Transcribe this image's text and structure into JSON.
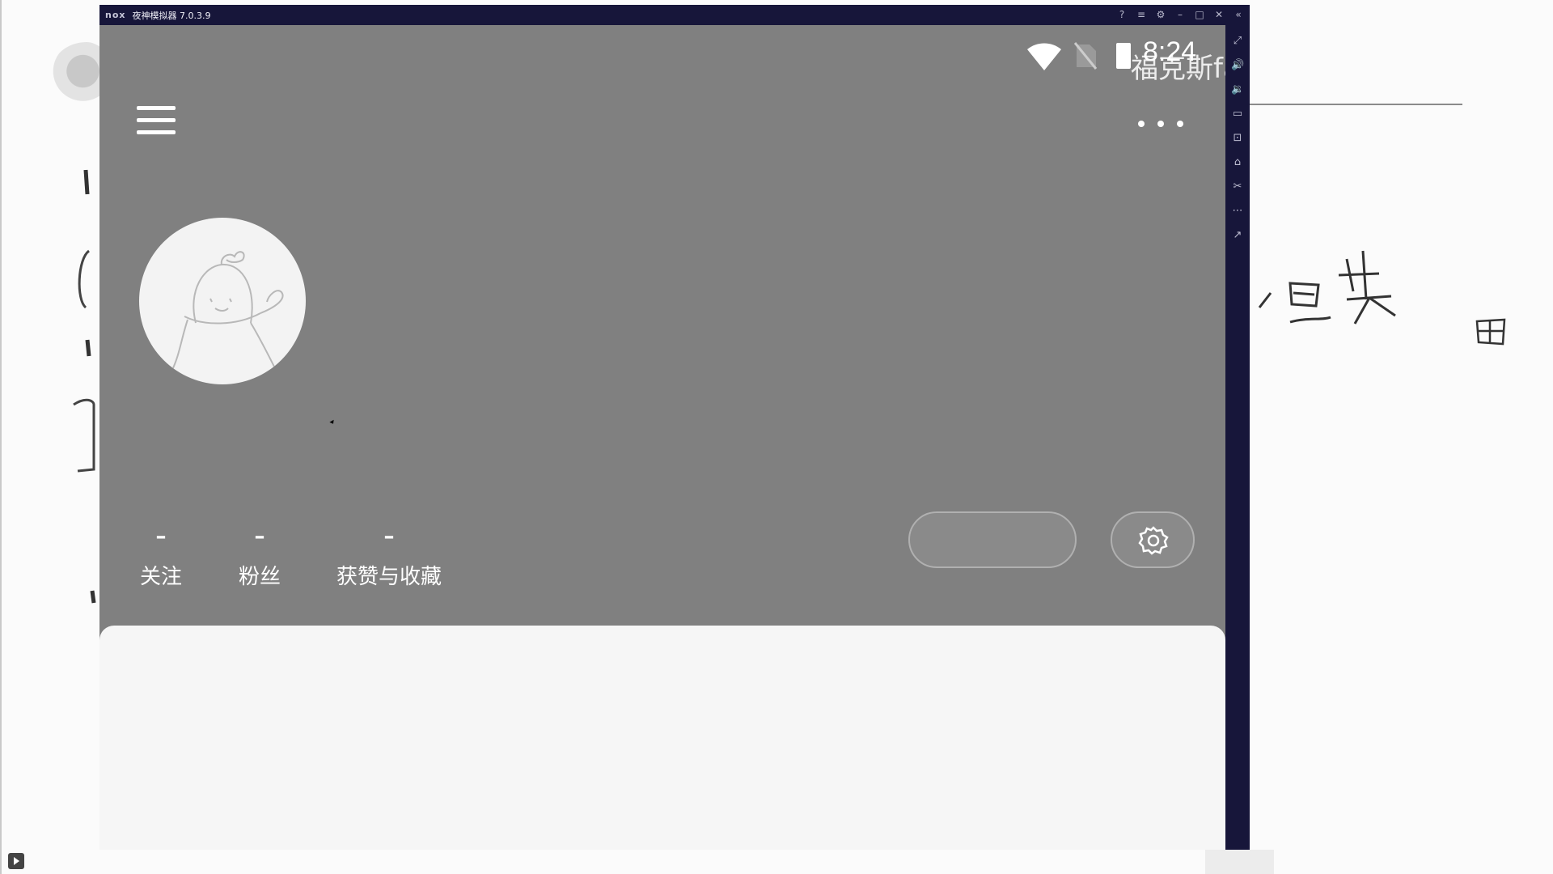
{
  "emulator": {
    "brand": "nox",
    "title": "夜神模拟器 7.0.3.9"
  },
  "status_bar": {
    "time": "8:24"
  },
  "overlay_caption": "福克斯fa",
  "profile": {
    "stats": [
      {
        "value": "–",
        "label": "关注"
      },
      {
        "value": "–",
        "label": "粉丝"
      },
      {
        "value": "–",
        "label": "获赞与收藏"
      }
    ]
  },
  "colors": {
    "header_bg": "#808080",
    "emulator_chrome": "#17163a",
    "panel_bg": "#f6f6f6"
  },
  "icons": {
    "menu": "hamburger-menu-icon",
    "more": "more-horizontal-icon",
    "settings": "gear-icon",
    "wifi": "wifi-icon",
    "sim": "no-sim-icon",
    "battery": "battery-icon"
  }
}
